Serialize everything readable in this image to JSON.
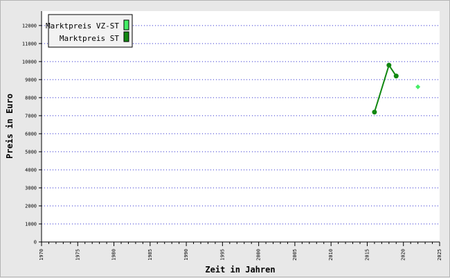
{
  "chart_data": {
    "type": "line",
    "xlabel": "Zeit in Jahren",
    "ylabel": "Preis in Euro",
    "xlim": [
      1970,
      2025
    ],
    "ylim": [
      0,
      12800
    ],
    "x_ticks": [
      1970,
      1975,
      1980,
      1985,
      1990,
      1995,
      2000,
      2005,
      2010,
      2015,
      2020,
      2025
    ],
    "y_ticks": [
      0,
      1000,
      2000,
      3000,
      4000,
      5000,
      6000,
      7000,
      8000,
      9000,
      10000,
      11000,
      12000
    ],
    "grid": "horizontal dotted",
    "legend_position": "top-left",
    "series": [
      {
        "name": "Marktpreis VZ-ST",
        "color": "#44ee66",
        "marker": "diamond",
        "line": false,
        "points": [
          {
            "x": 2022,
            "y": 8600
          }
        ]
      },
      {
        "name": "Marktpreis ST",
        "color": "#118811",
        "marker": "circle",
        "line": true,
        "points": [
          {
            "x": 2016,
            "y": 7200
          },
          {
            "x": 2018,
            "y": 9800
          },
          {
            "x": 2019,
            "y": 9200
          }
        ]
      }
    ]
  }
}
